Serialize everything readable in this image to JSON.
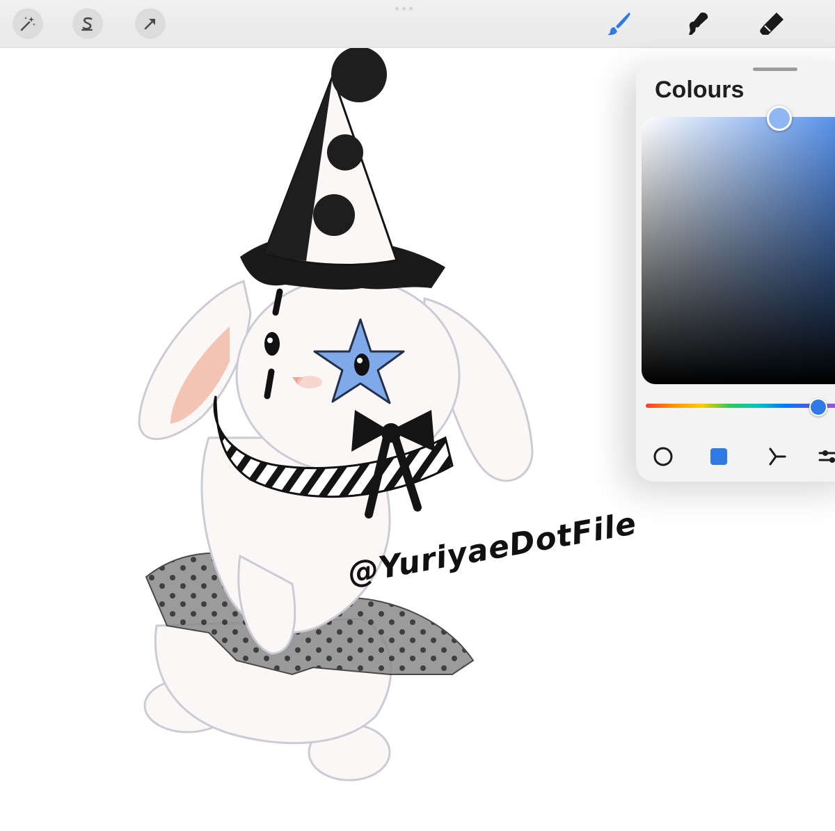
{
  "toolbar": {
    "left_tools": [
      {
        "icon": "adjustments-wand-icon"
      },
      {
        "icon": "selection-icon"
      },
      {
        "icon": "transform-arrow-icon"
      }
    ],
    "right_tools": [
      {
        "icon": "brush-icon",
        "active": true
      },
      {
        "icon": "smudge-icon",
        "active": false
      },
      {
        "icon": "eraser-icon",
        "active": false
      }
    ],
    "accent_color": "#2f7ae5"
  },
  "canvas": {
    "signature_text": "@YuriyaeDotFile"
  },
  "colours_panel": {
    "title": "Colours",
    "current_color": "#8fb8f2",
    "hue_color": "#3a7ee6",
    "tabs": [
      {
        "icon": "disc-mode-icon",
        "active": false
      },
      {
        "icon": "classic-mode-icon",
        "active": true
      },
      {
        "icon": "harmony-mode-icon",
        "active": false
      },
      {
        "icon": "value-sliders-icon",
        "active": false
      }
    ]
  }
}
